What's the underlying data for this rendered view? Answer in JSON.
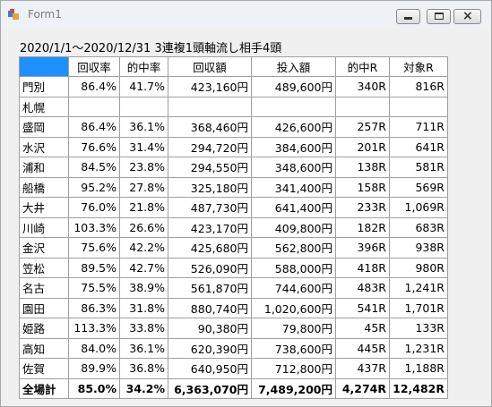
{
  "window": {
    "title": "Form1",
    "controls": {
      "minimize": "minimize",
      "maximize": "maximize",
      "close": "close"
    }
  },
  "heading": "2020/1/1～2020/12/31 3連複1頭軸流し相手4頭",
  "table": {
    "headers": [
      "",
      "回収率",
      "的中率",
      "回収額",
      "投入額",
      "的中R",
      "対象R"
    ],
    "header_corner_color": "#1e90ff",
    "rows": [
      [
        "門別",
        "86.4%",
        "41.7%",
        "423,160円",
        "489,600円",
        "340R",
        "816R"
      ],
      [
        "札幌",
        "",
        "",
        "",
        "",
        "",
        ""
      ],
      [
        "盛岡",
        "86.4%",
        "36.1%",
        "368,460円",
        "426,600円",
        "257R",
        "711R"
      ],
      [
        "水沢",
        "76.6%",
        "31.4%",
        "294,720円",
        "384,600円",
        "201R",
        "641R"
      ],
      [
        "浦和",
        "84.5%",
        "23.8%",
        "294,550円",
        "348,600円",
        "138R",
        "581R"
      ],
      [
        "船橋",
        "95.2%",
        "27.8%",
        "325,180円",
        "341,400円",
        "158R",
        "569R"
      ],
      [
        "大井",
        "76.0%",
        "21.8%",
        "487,730円",
        "641,400円",
        "233R",
        "1,069R"
      ],
      [
        "川崎",
        "103.3%",
        "26.6%",
        "423,170円",
        "409,800円",
        "182R",
        "683R"
      ],
      [
        "金沢",
        "75.6%",
        "42.2%",
        "425,680円",
        "562,800円",
        "396R",
        "938R"
      ],
      [
        "笠松",
        "89.5%",
        "42.7%",
        "526,090円",
        "588,000円",
        "418R",
        "980R"
      ],
      [
        "名古",
        "75.5%",
        "38.9%",
        "561,870円",
        "744,600円",
        "483R",
        "1,241R"
      ],
      [
        "園田",
        "86.3%",
        "31.8%",
        "880,740円",
        "1,020,600円",
        "541R",
        "1,701R"
      ],
      [
        "姫路",
        "113.3%",
        "33.8%",
        "90,380円",
        "79,800円",
        "45R",
        "133R"
      ],
      [
        "高知",
        "84.0%",
        "36.1%",
        "620,390円",
        "738,600円",
        "445R",
        "1,231R"
      ],
      [
        "佐賀",
        "89.9%",
        "36.8%",
        "640,950円",
        "712,800円",
        "437R",
        "1,188R"
      ]
    ],
    "total": [
      "全場計",
      "85.0%",
      "34.2%",
      "6,363,070円",
      "7,489,200円",
      "4,274R",
      "12,482R"
    ]
  }
}
